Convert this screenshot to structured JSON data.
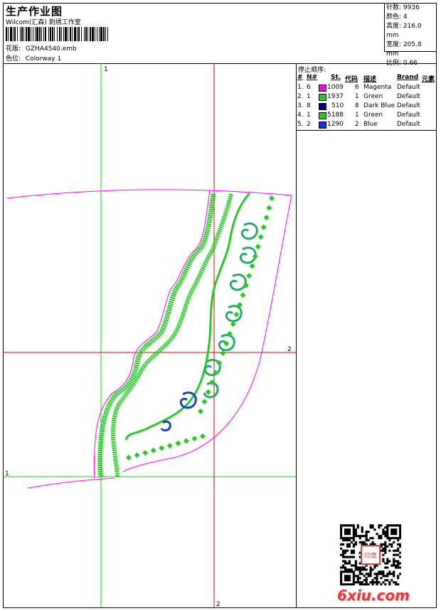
{
  "header": {
    "title": "生产作业图",
    "subtitle": "Wilcom(汇森) 刺绣工作室",
    "design_label": "花版:",
    "design_value": "GZHA4540.emb",
    "colorway_label": "色位:",
    "colorway_value": "Colorway 1"
  },
  "stats": {
    "stitches_label": "针数:",
    "stitches_value": "9936",
    "colors_label": "颜色:",
    "colors_value": "4",
    "height_label": "高度:",
    "height_value": "216.0 mm",
    "width_label": "宽度:",
    "width_value": "205.8 mm",
    "scale_label": "比例:",
    "scale_value": "0.66"
  },
  "stop_sequence": {
    "title": "停止顺序:",
    "headers": {
      "num": "#",
      "needle": "N#",
      "stitches": "St.",
      "code": "代码",
      "desc": "描述",
      "brand": "Brand",
      "element": "元素"
    },
    "rows": [
      {
        "num": "1.",
        "needle": "6",
        "color": "#ff00ff",
        "stitches": "1009",
        "code": "6",
        "desc": "Magenta",
        "brand": "Default"
      },
      {
        "num": "2.",
        "needle": "1",
        "color": "#22cc22",
        "stitches": "1937",
        "code": "1",
        "desc": "Green",
        "brand": "Default"
      },
      {
        "num": "3.",
        "needle": "8",
        "color": "#00008b",
        "stitches": "510",
        "code": "8",
        "desc": "Dark Blue",
        "brand": "Default"
      },
      {
        "num": "4.",
        "needle": "1",
        "color": "#22cc22",
        "stitches": "5188",
        "code": "1",
        "desc": "Green",
        "brand": "Default"
      },
      {
        "num": "5.",
        "needle": "2",
        "color": "#0033ff",
        "stitches": "1290",
        "code": "2",
        "desc": "Blue",
        "brand": "Default"
      }
    ]
  },
  "guides": {
    "v1_label": "1",
    "h1_label": "1",
    "v2_label": "2",
    "h2_label": "2"
  },
  "watermark": {
    "site": "6xiu.com",
    "stamp_text": "印章"
  },
  "colors": {
    "magenta": "#ff00ff",
    "green": "#22cc22",
    "guide_green": "#00dd00",
    "guide_red": "#e00000",
    "dark_blue": "#00008b"
  }
}
